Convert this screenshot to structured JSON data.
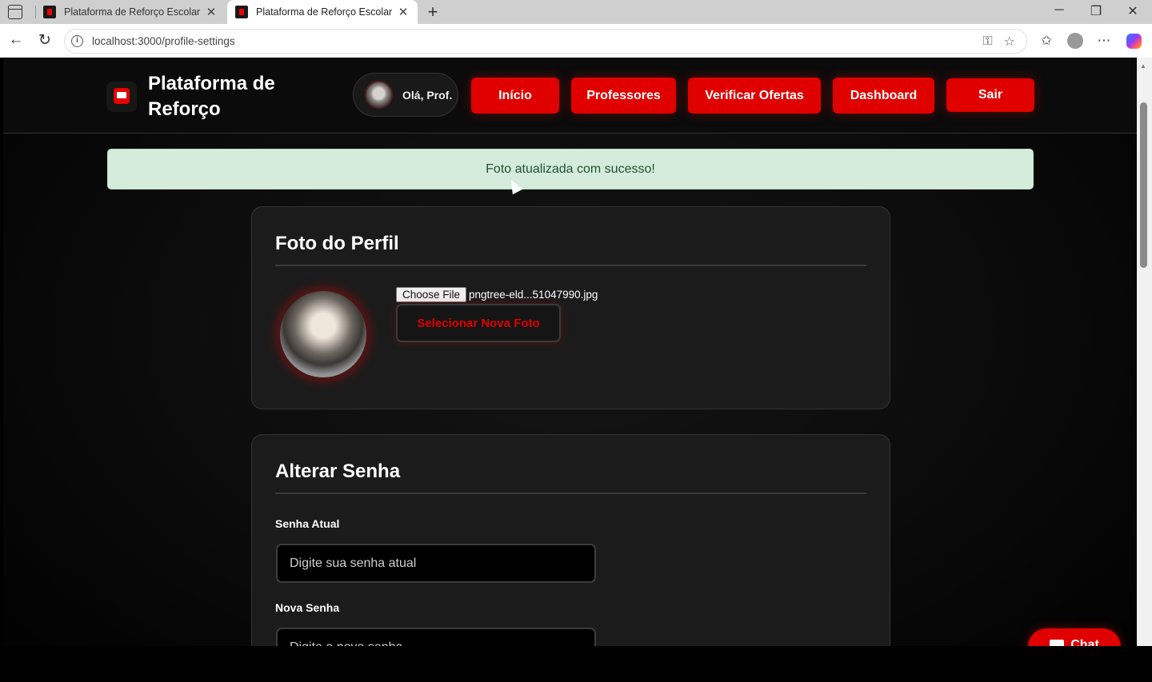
{
  "browser": {
    "tabs": [
      {
        "title": "Plataforma de Reforço Escolar",
        "active": false
      },
      {
        "title": "Plataforma de Reforço Escolar",
        "active": true
      }
    ],
    "url": "localhost:3000/profile-settings"
  },
  "header": {
    "brand": "Plataforma de Reforço",
    "greeting": "Olá, Prof.",
    "nav": [
      {
        "label": "Início"
      },
      {
        "label": "Professores"
      },
      {
        "label": "Verificar Ofertas"
      },
      {
        "label": "Dashboard"
      },
      {
        "label": "Sair"
      }
    ]
  },
  "alert": {
    "message": "Foto atualizada com sucesso!"
  },
  "photo_card": {
    "title": "Foto do Perfil",
    "file_button": "Choose File",
    "file_name": "pngtree-eld...51047990.jpg",
    "select_button": "Selecionar Nova Foto"
  },
  "password_card": {
    "title": "Alterar Senha",
    "current_label": "Senha Atual",
    "current_placeholder": "Digite sua senha atual",
    "new_label": "Nova Senha",
    "new_placeholder": "Digite a nova senha"
  },
  "chat": {
    "label": "Chat"
  },
  "colors": {
    "accent": "#e00000",
    "alert_bg": "#d5ecdc",
    "alert_text": "#1f5230",
    "card_bg": "#1b1b1b"
  }
}
